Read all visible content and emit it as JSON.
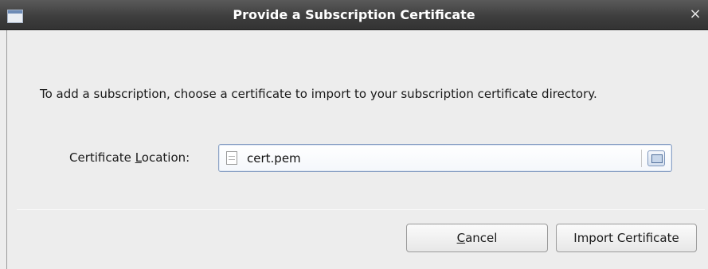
{
  "window": {
    "title": "Provide a Subscription Certificate",
    "close_glyph": "×",
    "app_icon": "window-icon"
  },
  "message": "To add a subscription, choose a certificate to import to your subscription certificate directory.",
  "location": {
    "label_prefix": "Certificate ",
    "label_mnemonic": "L",
    "label_suffix": "ocation:",
    "value": "cert.pem",
    "file_icon": "document-icon",
    "browse_icon": "folder-icon"
  },
  "buttons": {
    "cancel_mnemonic": "C",
    "cancel_rest": "ancel",
    "import_label": "Import Certificate"
  },
  "colors": {
    "titlebar": "#3e3e3e",
    "dialog_bg": "#ededed",
    "field_border": "#8da3c6"
  }
}
